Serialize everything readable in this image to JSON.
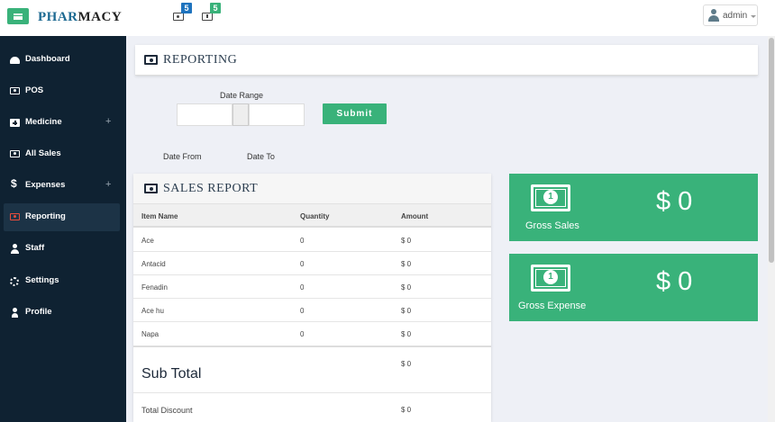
{
  "header": {
    "brand_part1": "PHAR",
    "brand_part2": "MACY",
    "notifications": [
      {
        "icon": "money-icon",
        "count": "5",
        "color": "#1e73be"
      },
      {
        "icon": "medkit-icon",
        "count": "5",
        "color": "#39b27a"
      }
    ],
    "user": "admin"
  },
  "sidebar": {
    "items": [
      {
        "label": "Dashboard",
        "icon": "dashboard-icon"
      },
      {
        "label": "POS",
        "icon": "money-icon"
      },
      {
        "label": "Medicine",
        "icon": "medkit-icon",
        "expand": "+"
      },
      {
        "label": "All Sales",
        "icon": "money-icon"
      },
      {
        "label": "Expenses",
        "icon": "dollar-icon",
        "expand": "+"
      },
      {
        "label": "Reporting",
        "icon": "money-icon",
        "active": true
      },
      {
        "label": "Staff",
        "icon": "staff-icon"
      },
      {
        "label": "Settings",
        "icon": "gears-icon"
      },
      {
        "label": "Profile",
        "icon": "user-icon"
      }
    ]
  },
  "reporting": {
    "title": "REPORTING",
    "date_range_label": "Date Range",
    "from_value": "",
    "to_value": "",
    "submit_label": "Submit",
    "date_from_label": "Date From",
    "date_to_label": "Date To"
  },
  "sales_report": {
    "title": "SALES REPORT",
    "columns": [
      "Item Name",
      "Quantity",
      "Amount"
    ],
    "rows": [
      {
        "name": "Ace",
        "qty": "0",
        "amount": "$ 0"
      },
      {
        "name": "Antacid",
        "qty": "0",
        "amount": "$ 0"
      },
      {
        "name": "Fenadin",
        "qty": "0",
        "amount": "$ 0"
      },
      {
        "name": "Ace hu",
        "qty": "0",
        "amount": "$ 0"
      },
      {
        "name": "Napa",
        "qty": "0",
        "amount": "$ 0"
      }
    ],
    "subtotal_label": "Sub Total",
    "subtotal_value": "$ 0",
    "discount_label": "Total Discount",
    "discount_value": "$ 0"
  },
  "stats": {
    "gross_sales": {
      "label": "Gross Sales",
      "value": "$ 0"
    },
    "gross_expense": {
      "label": "Gross Expense",
      "value": "$ 0"
    },
    "bill_digit": "1",
    "color": "#39b27a"
  }
}
